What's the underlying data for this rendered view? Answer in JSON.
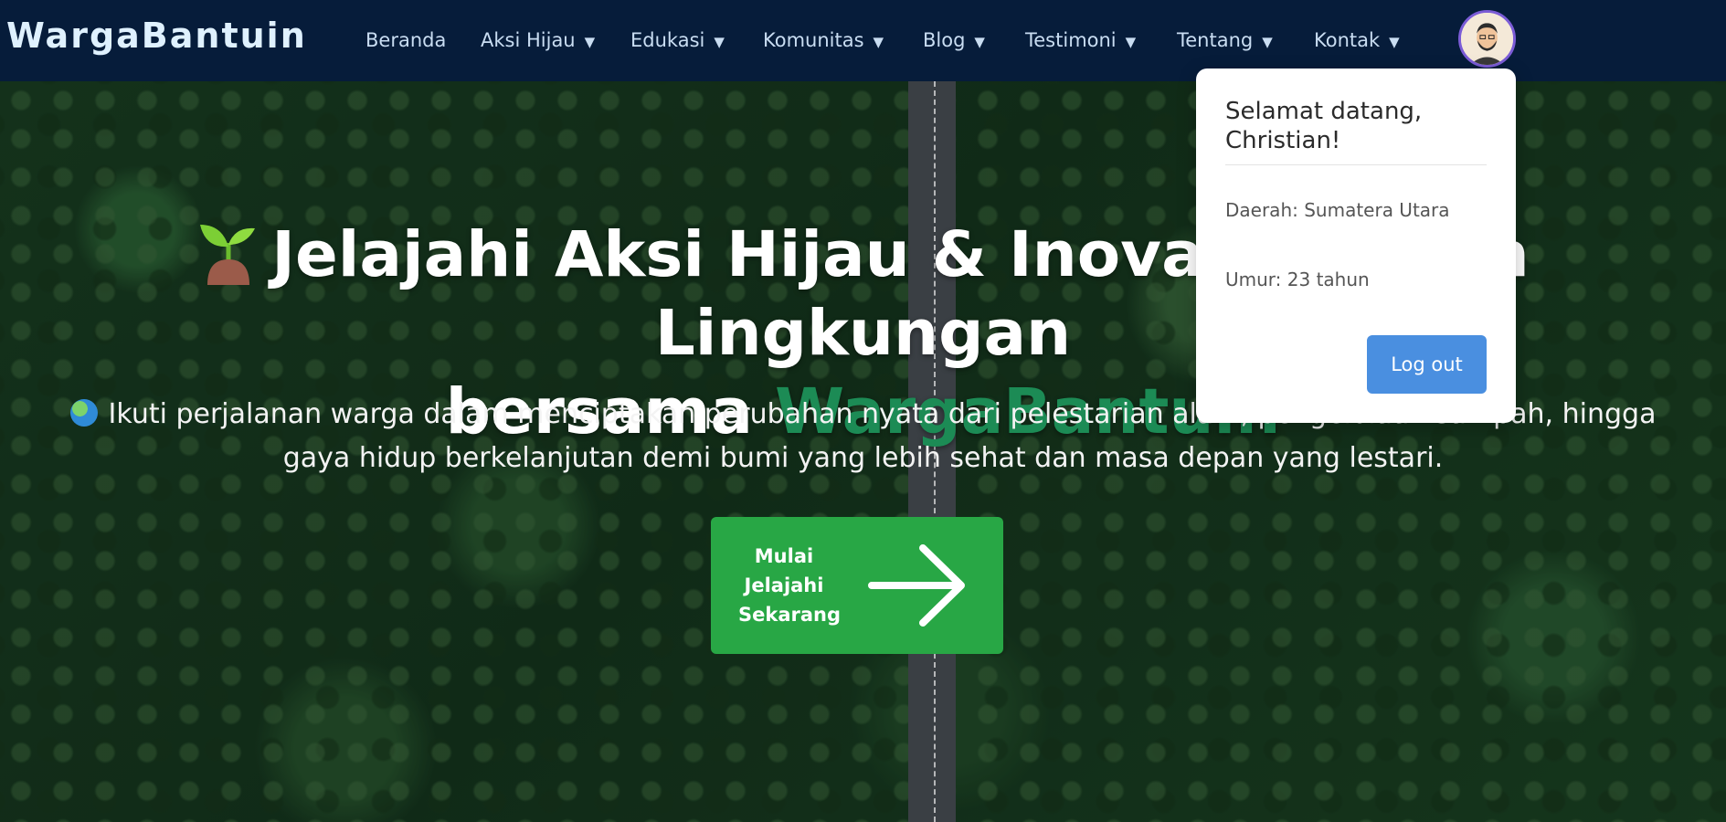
{
  "brand": "WargaBantuin",
  "nav": {
    "items": [
      {
        "label": "Beranda",
        "caret": ""
      },
      {
        "label": "Aksi Hijau",
        "caret": "▼"
      },
      {
        "label": "Edukasi",
        "caret": "▼"
      },
      {
        "label": "Komunitas",
        "caret": "▼"
      },
      {
        "label": "Blog",
        "caret": "▼"
      },
      {
        "label": "Testimoni",
        "caret": "▼"
      },
      {
        "label": "Tentang",
        "caret": "▼"
      },
      {
        "label": "Kontak",
        "caret": "▼"
      }
    ],
    "avatar_icon": "user-avatar-icon"
  },
  "profile_menu": {
    "greeting": "Selamat datang, Christian!",
    "region": "Daerah: Sumatera Utara",
    "age": "Umur: 23 tahun",
    "logout_label": "Log out"
  },
  "hero": {
    "title_line1": "Jelajahi Aksi Hijau & Inovasi Ramah Lingkungan",
    "title_line2_prefix": "bersama ",
    "title_line2_accent": "WargaBantuin",
    "title_icon": "sprout-icon",
    "subtitle": "Ikuti perjalanan warga dalam menciptakan perubahan nyata dari pelestarian alam, pengelolaan sampah, hingga gaya hidup berkelanjutan demi bumi yang lebih sehat dan masa depan yang lestari.",
    "subtitle_icon": "globe-icon",
    "cta_label": "Mulai Jelajahi Sekarang",
    "cta_icon": "arrow-right-icon"
  },
  "colors": {
    "navbar": "#061c3a",
    "accent_green": "#1c8b55",
    "cta_green": "#28a745",
    "logout_blue": "#4a8fe0"
  }
}
